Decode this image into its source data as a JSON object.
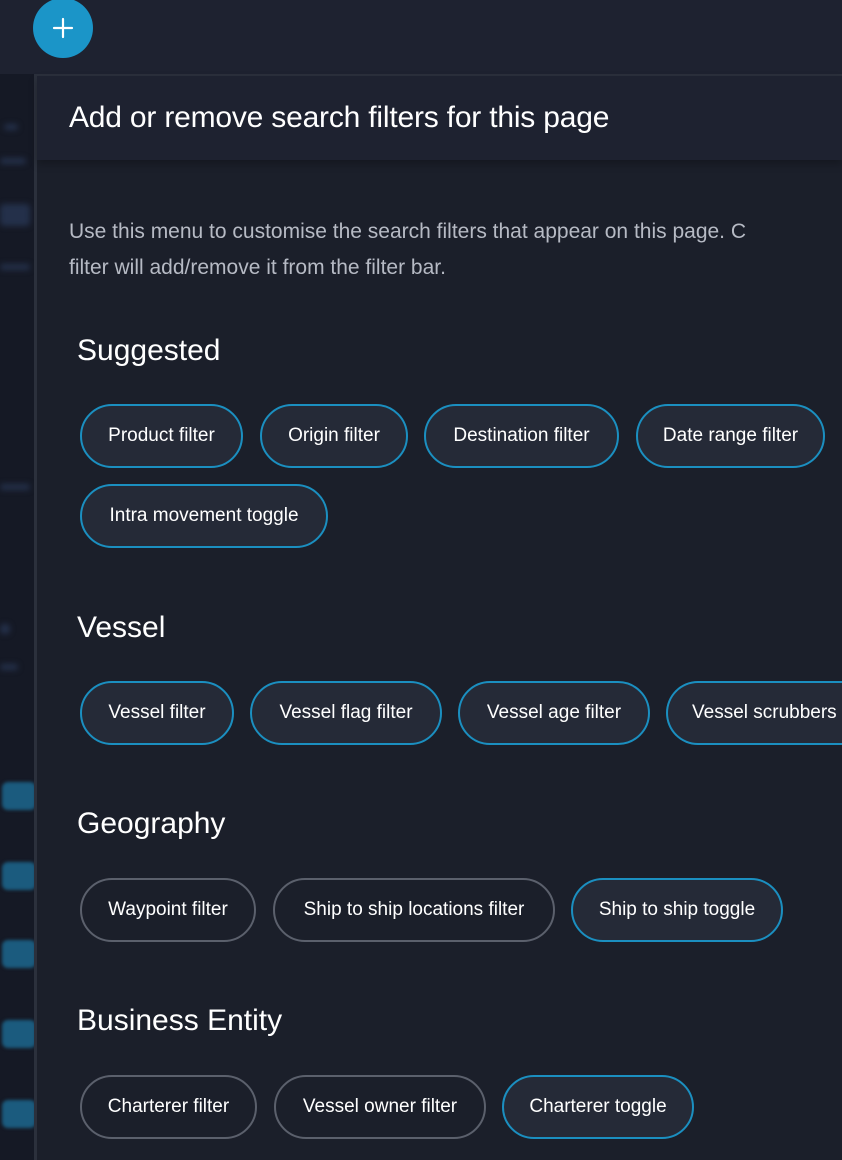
{
  "header": {
    "add_icon": "plus-icon",
    "accent_color": "#1b95c8"
  },
  "panel": {
    "title": "Add or remove search filters for this page",
    "intro_line1": "Use this menu to customise the search filters that appear on this page. C",
    "intro_line2": "filter will add/remove it from the filter bar."
  },
  "sections": {
    "suggested": {
      "title": "Suggested",
      "items": [
        {
          "label": "Product filter",
          "active": true
        },
        {
          "label": "Origin filter",
          "active": true
        },
        {
          "label": "Destination filter",
          "active": true
        },
        {
          "label": "Date range filter",
          "active": true
        },
        {
          "label": "Intra movement toggle",
          "active": true
        }
      ]
    },
    "vessel": {
      "title": "Vessel",
      "items": [
        {
          "label": "Vessel filter",
          "active": true
        },
        {
          "label": "Vessel flag filter",
          "active": true
        },
        {
          "label": "Vessel age filter",
          "active": true
        },
        {
          "label": "Vessel scrubbers",
          "active": true
        }
      ]
    },
    "geography": {
      "title": "Geography",
      "items": [
        {
          "label": "Waypoint filter",
          "active": false
        },
        {
          "label": "Ship to ship locations filter",
          "active": false
        },
        {
          "label": "Ship to ship toggle",
          "active": true
        }
      ]
    },
    "business": {
      "title": "Business Entity",
      "items": [
        {
          "label": "Charterer filter",
          "active": false
        },
        {
          "label": "Vessel owner filter",
          "active": false
        },
        {
          "label": "Charterer toggle",
          "active": true
        }
      ]
    }
  },
  "colors": {
    "active_border": "#1b8fc0",
    "inactive_border": "#5b606c",
    "background": "#1b1f2a"
  }
}
